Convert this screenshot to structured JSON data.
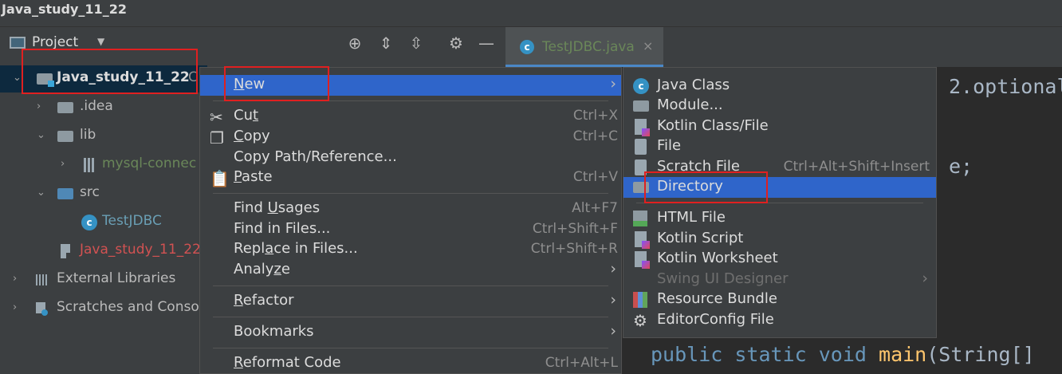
{
  "window": {
    "title": "Java_study_11_22"
  },
  "project_panel": {
    "title": "Project",
    "tree": [
      {
        "label": "Java_study_11_22",
        "suffix": "C",
        "color": "#dcdcdc",
        "bold": true
      },
      {
        "label": ".idea",
        "color": "#bbbbbb"
      },
      {
        "label": "lib",
        "color": "#bbbbbb"
      },
      {
        "label": "mysql-connec",
        "color": "#6a8759"
      },
      {
        "label": "src",
        "color": "#bbbbbb"
      },
      {
        "label": "TestJDBC",
        "color": "#6a9fb5"
      },
      {
        "label": "Java_study_11_22",
        "color": "#d25252"
      },
      {
        "label": "External Libraries",
        "color": "#bbbbbb"
      },
      {
        "label": "Scratches and Conso",
        "color": "#bbbbbb"
      }
    ]
  },
  "editor": {
    "tab": {
      "label": "TestJDBC.java",
      "close": "×"
    },
    "code_lines": [
      "2.optional",
      "e;"
    ],
    "main_line": {
      "kw1": "public",
      "kw2": "static",
      "kw3": "void",
      "fn": "main",
      "rest": "(String[]"
    }
  },
  "context_menu": {
    "items": [
      {
        "label": "New",
        "mnemonic": "N",
        "rest": "ew",
        "submenu": true,
        "selected": true
      },
      {
        "label": "Cut",
        "pre": "Cu",
        "mnemonic": "t",
        "rest": "",
        "shortcut": "Ctrl+X",
        "icon": "scissors-icon"
      },
      {
        "label": "Copy",
        "pre": "",
        "mnemonic": "C",
        "rest": "opy",
        "shortcut": "Ctrl+C",
        "icon": "copy-icon"
      },
      {
        "label": "Copy Path/Reference...",
        "shortcut": ""
      },
      {
        "label": "Paste",
        "pre": "",
        "mnemonic": "P",
        "rest": "aste",
        "shortcut": "Ctrl+V",
        "icon": "paste-icon"
      },
      {
        "label": "Find Usages",
        "pre": "Find ",
        "mnemonic": "U",
        "rest": "sages",
        "shortcut": "Alt+F7"
      },
      {
        "label": "Find in Files...",
        "shortcut": "Ctrl+Shift+F"
      },
      {
        "label": "Replace in Files...",
        "pre": "Repl",
        "mnemonic": "a",
        "rest": "ce in Files...",
        "shortcut": "Ctrl+Shift+R"
      },
      {
        "label": "Analyze",
        "pre": "Analy",
        "mnemonic": "z",
        "rest": "e",
        "submenu": true
      },
      {
        "label": "Refactor",
        "pre": "",
        "mnemonic": "R",
        "rest": "efactor",
        "submenu": true
      },
      {
        "label": "Bookmarks",
        "submenu": true
      },
      {
        "label": "Reformat Code",
        "pre": "",
        "mnemonic": "R",
        "rest": "eformat Code",
        "shortcut": "Ctrl+Alt+L"
      }
    ]
  },
  "new_submenu": {
    "items": [
      {
        "label": "Java Class",
        "icon": "java-class-icon"
      },
      {
        "label": "Module...",
        "icon": "module-icon"
      },
      {
        "label": "Kotlin Class/File",
        "icon": "kotlin-class-icon"
      },
      {
        "label": "File",
        "icon": "file-icon"
      },
      {
        "label": "Scratch File",
        "shortcut": "Ctrl+Alt+Shift+Insert",
        "icon": "scratch-file-icon"
      },
      {
        "label": "Directory",
        "icon": "directory-icon",
        "selected": true
      },
      {
        "label": "HTML File",
        "icon": "html-file-icon"
      },
      {
        "label": "Kotlin Script",
        "icon": "kotlin-script-icon"
      },
      {
        "label": "Kotlin Worksheet",
        "icon": "kotlin-worksheet-icon"
      },
      {
        "label": "Swing UI Designer",
        "disabled": true,
        "submenu": true
      },
      {
        "label": "Resource Bundle",
        "icon": "resource-bundle-icon"
      },
      {
        "label": "EditorConfig File",
        "icon": "editorconfig-icon"
      }
    ]
  },
  "glyphs": {
    "chevron": "›",
    "expanded": "⌄",
    "collapsed": "›",
    "dropdown": "▼"
  },
  "colors": {
    "selection": "#2f65ca",
    "highlight_box": "#e02020",
    "menu_bg": "#3c3f41"
  }
}
